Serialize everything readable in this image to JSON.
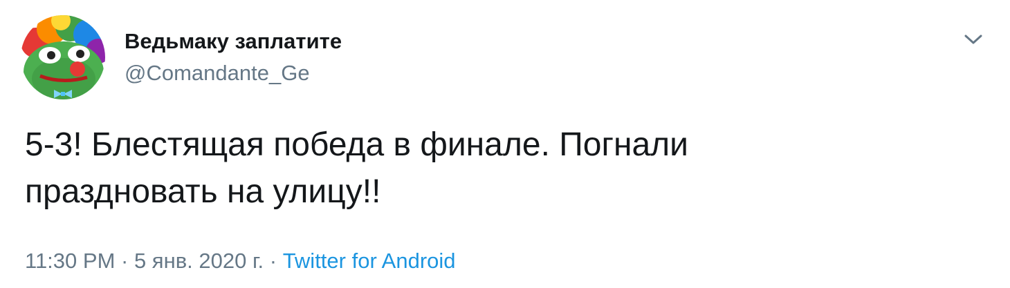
{
  "author": {
    "display_name": "Ведьмаку заплатите",
    "handle": "@Comandante_Ge"
  },
  "tweet": {
    "text_line1": "5-3! Блестящая победа в финале. Погнали",
    "text_line2": "праздновать на улицу!!"
  },
  "meta": {
    "time": "11:30 PM",
    "sep1": " · ",
    "date": "5 янв. 2020 г.",
    "sep2": " · ",
    "source": "Twitter for Android"
  },
  "icons": {
    "menu": "chevron-down-icon",
    "avatar": "clown-frog-avatar"
  },
  "colors": {
    "text_primary": "#14171a",
    "text_secondary": "#657786",
    "link": "#1b95e0"
  }
}
